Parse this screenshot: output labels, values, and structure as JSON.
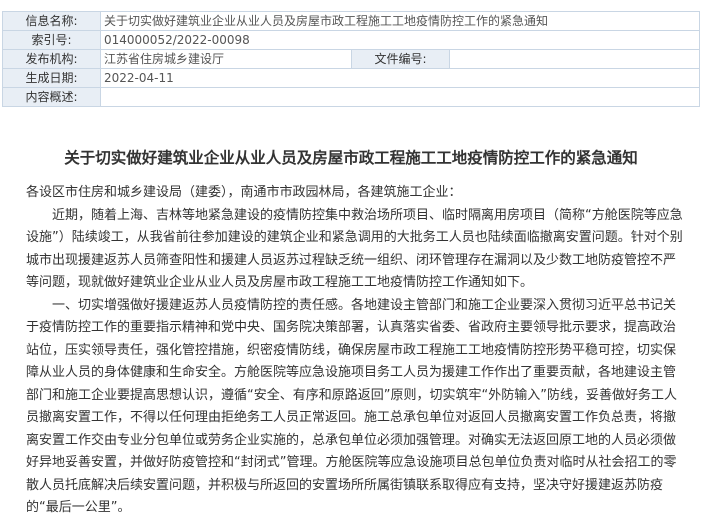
{
  "meta": {
    "title_label": "信息名称:",
    "title_value": "关于切实做好建筑业企业从业人员及房屋市政工程施工工地疫情防控工作的紧急通知",
    "index_label": "索引号:",
    "index_value": "014000052/2022-00098",
    "publisher_label": "发布机构:",
    "publisher_value": "江苏省住房城乡建设厅",
    "docno_label": "文件编号:",
    "docno_value": "",
    "date_label": "生成日期:",
    "date_value": "2022-04-11",
    "summary_label": "内容概述:",
    "summary_value": ""
  },
  "document": {
    "title": "关于切实做好建筑业企业从业人员及房屋市政工程施工工地疫情防控工作的紧急通知",
    "salutation": "各设区市住房和城乡建设局（建委），南通市市政园林局，各建筑施工企业：",
    "paragraphs": [
      "近期，随着上海、吉林等地紧急建设的疫情防控集中救治场所项目、临时隔离用房项目（简称“方舱医院等应急设施”）陆续竣工，从我省前往参加建设的建筑企业和紧急调用的大批务工人员也陆续面临撤离安置问题。针对个别城市出现援建返苏人员筛查阳性和援建人员返苏过程缺乏统一组织、闭环管理存在漏洞以及少数工地防疫管控不严等问题，现就做好建筑业企业从业人员及房屋市政工程施工工地疫情防控工作通知如下。",
      "一、切实增强做好援建返苏人员疫情防控的责任感。各地建设主管部门和施工企业要深入贯彻习近平总书记关于疫情防控工作的重要指示精神和党中央、国务院决策部署，认真落实省委、省政府主要领导批示要求，提高政治站位，压实领导责任，强化管控措施，织密疫情防线，确保房屋市政工程施工工地疫情防控形势平稳可控，切实保障从业人员的身体健康和生命安全。方舱医院等应急设施项目务工人员为援建工作作出了重要贡献，各地建设主管部门和施工企业要提高思想认识，遵循“安全、有序和原路返回”原则，切实筑牢“外防输入”防线，妥善做好务工人员撤离安置工作，不得以任何理由拒绝务工人员正常返回。施工总承包单位对返回人员撤离安置工作负总责，将撤离安置工作交由专业分包单位或劳务企业实施的，总承包单位必须加强管理。对确实无法返回原工地的人员必须做好异地妥善安置，并做好防疫管控和“封闭式”管理。方舱医院等应急设施项目总包单位负责对临时从社会招工的零散人员托底解决后续安置问题，并积极与所返回的安置场所所属街镇联系取得应有支持，坚决守好援建返苏防疫的“最后一公里”。"
    ]
  }
}
